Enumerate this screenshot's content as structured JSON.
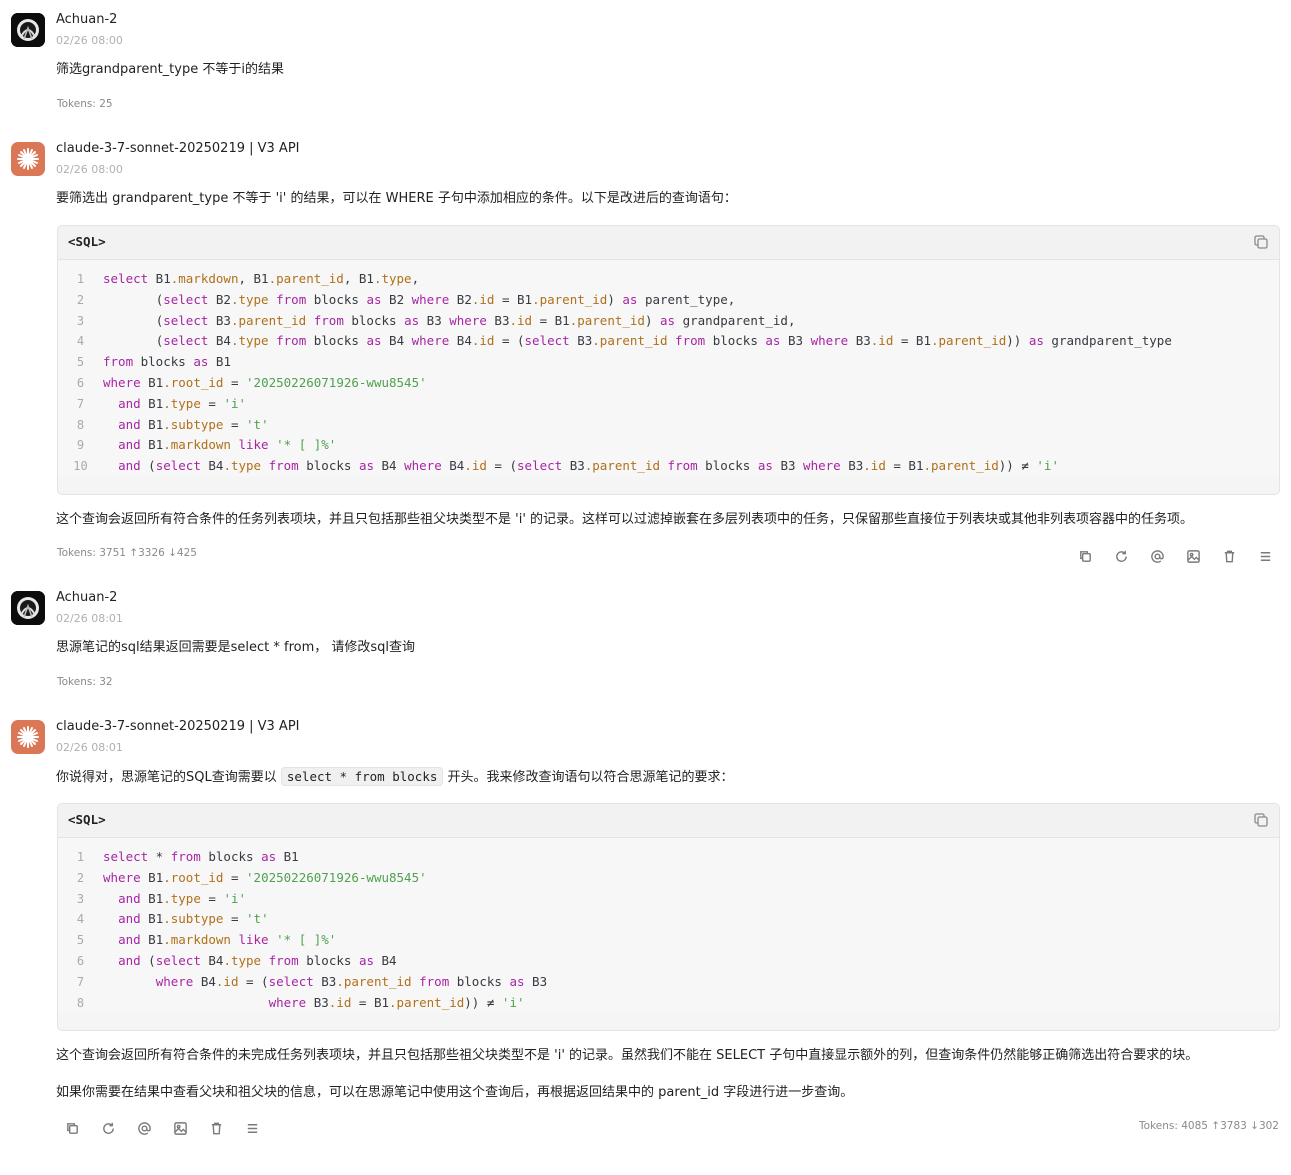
{
  "messages": [
    {
      "role": "user",
      "name": "Achuan-2",
      "time": "02/26 08:00",
      "text": "筛选grandparent_type 不等于i的结果",
      "tokens": "Tokens: 25"
    },
    {
      "role": "assistant",
      "name": "claude-3-7-sonnet-20250219 | V3 API",
      "time": "02/26 08:00",
      "intro": "要筛选出 grandparent_type 不等于 'i' 的结果，可以在 WHERE 子句中添加相应的条件。以下是改进后的查询语句：",
      "code_lang": "<SQL>",
      "code_line_numbers": [
        "1",
        "2",
        "3",
        "4",
        "5",
        "6",
        "7",
        "8",
        "9",
        "10"
      ],
      "outro": "这个查询会返回所有符合条件的任务列表项块，并且只包括那些祖父块类型不是 'i' 的记录。这样可以过滤掉嵌套在多层列表项中的任务，只保留那些直接位于列表块或其他非列表项容器中的任务项。",
      "tokens": "Tokens: 3751 ↑3326 ↓425"
    },
    {
      "role": "user",
      "name": "Achuan-2",
      "time": "02/26 08:01",
      "text": "思源笔记的sql结果返回需要是select * from， 请修改sql查询",
      "tokens": "Tokens: 32"
    },
    {
      "role": "assistant",
      "name": "claude-3-7-sonnet-20250219 | V3 API",
      "time": "02/26 08:01",
      "intro_before": "你说得对，思源笔记的SQL查询需要以",
      "intro_code": "select * from blocks",
      "intro_after": "开头。我来修改查询语句以符合思源笔记的要求：",
      "code_lang": "<SQL>",
      "code_line_numbers": [
        "1",
        "2",
        "3",
        "4",
        "5",
        "6",
        "7",
        "8"
      ],
      "outro1": "这个查询会返回所有符合条件的未完成任务列表项块，并且只包括那些祖父块类型不是 'i' 的记录。虽然我们不能在 SELECT 子句中直接显示额外的列，但查询条件仍然能够正确筛选出符合要求的块。",
      "outro2": "如果你需要在结果中查看父块和祖父块的信息，可以在思源笔记中使用这个查询后，再根据返回结果中的 parent_id 字段进行进一步查询。",
      "tokens": "Tokens: 4085 ↑3783 ↓302"
    }
  ],
  "code1": {
    "l1": [
      "select",
      " B1",
      ".markdown",
      ", B1",
      ".parent_id",
      ", B1",
      ".type",
      ","
    ],
    "l2": [
      "(",
      "select",
      " B2",
      ".type",
      " from",
      " blocks ",
      "as",
      " B2 ",
      "where",
      " B2",
      ".id",
      " = B1",
      ".parent_id",
      ") ",
      "as",
      " parent_type,"
    ],
    "l3": [
      "(",
      "select",
      " B3",
      ".parent_id",
      " from",
      " blocks ",
      "as",
      " B3 ",
      "where",
      " B3",
      ".id",
      " = B1",
      ".parent_id",
      ") ",
      "as",
      " grandparent_id,"
    ],
    "l4": [
      "(",
      "select",
      " B4",
      ".type",
      " from",
      " blocks ",
      "as",
      " B4 ",
      "where",
      " B4",
      ".id",
      " = (",
      "select",
      " B3",
      ".parent_id",
      " from",
      " blocks ",
      "as",
      " B3 ",
      "where",
      " B3",
      ".id",
      " = B1",
      ".parent_id",
      ")) ",
      "as",
      " grandparent_type"
    ],
    "l5": [
      "from",
      " blocks ",
      "as",
      " B1"
    ],
    "l6": [
      "where",
      " B1",
      ".root_id",
      " = ",
      "'20250226071926-wwu8545'"
    ],
    "l7": [
      "and",
      " B1",
      ".type",
      " = ",
      "'i'"
    ],
    "l8": [
      "and",
      " B1",
      ".subtype",
      " = ",
      "'t'"
    ],
    "l9": [
      "and",
      " B1",
      ".markdown",
      " ",
      "like",
      " ",
      "'* [ ]%'"
    ],
    "l10": [
      "and",
      " (",
      "select",
      " B4",
      ".type",
      " ",
      "from",
      " blocks ",
      "as",
      " B4 ",
      "where",
      " B4",
      ".id",
      " = (",
      "select",
      " B3",
      ".parent_id",
      " ",
      "from",
      " blocks ",
      "as",
      " B3 ",
      "where",
      " B3",
      ".id",
      " = B1",
      ".parent_id",
      ")) ≠ ",
      "'i'"
    ]
  },
  "code2": {
    "l1": [
      "select",
      " * ",
      "from",
      " blocks ",
      "as",
      " B1"
    ],
    "l2": [
      "where",
      " B1",
      ".root_id",
      " = ",
      "'20250226071926-wwu8545'"
    ],
    "l3": [
      "and",
      " B1",
      ".type",
      " = ",
      "'i'"
    ],
    "l4": [
      "and",
      " B1",
      ".subtype",
      " = ",
      "'t'"
    ],
    "l5": [
      "and",
      " B1",
      ".markdown",
      " ",
      "like",
      " ",
      "'* [ ]%'"
    ],
    "l6": [
      "and",
      " (",
      "select",
      " B4",
      ".type",
      " ",
      "from",
      " blocks ",
      "as",
      " B4"
    ],
    "l7": [
      "where",
      " B4",
      ".id",
      " = (",
      "select",
      " B3",
      ".parent_id",
      " ",
      "from",
      " blocks ",
      "as",
      " B3"
    ],
    "l8": [
      "where",
      " B3",
      ".id",
      " = B1",
      ".parent_id",
      ")) ≠ ",
      "'i'"
    ]
  },
  "icons": [
    "copy-icon",
    "regenerate-icon",
    "mention-icon",
    "image-icon",
    "delete-icon",
    "menu-icon"
  ],
  "colors": {
    "keyword": "#a626a4",
    "string": "#50a14f",
    "property": "#b0701a",
    "bot_avatar": "#d97757"
  }
}
